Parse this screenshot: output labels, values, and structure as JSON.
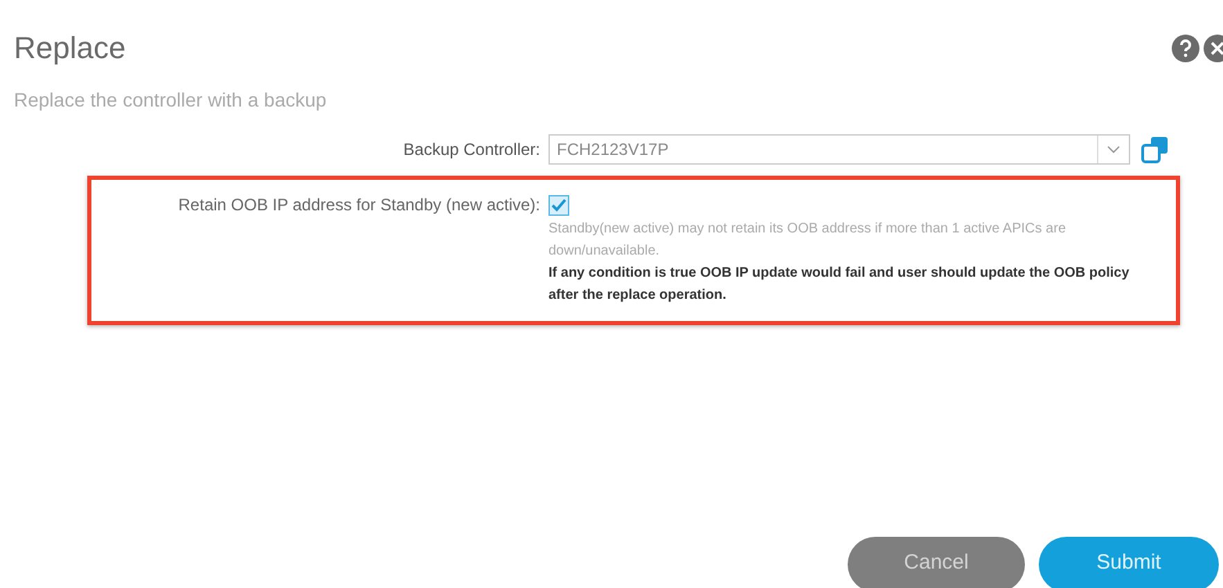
{
  "dialog": {
    "title": "Replace",
    "subtitle": "Replace the controller with a backup"
  },
  "backup_controller": {
    "label": "Backup Controller:",
    "value": "FCH2123V17P"
  },
  "retain_oob": {
    "label": "Retain OOB IP address for Standby (new active):",
    "checked": true,
    "highlighted": true,
    "note": "Standby(new active) may not retain its OOB address if more than 1 active APICs are down/unavailable.",
    "warning": "If any condition is true OOB IP update would fail and user should update the OOB policy after the replace operation."
  },
  "buttons": [
    {
      "label": "Cancel",
      "kind": "secondary"
    },
    {
      "label": "Submit",
      "kind": "primary"
    }
  ]
}
